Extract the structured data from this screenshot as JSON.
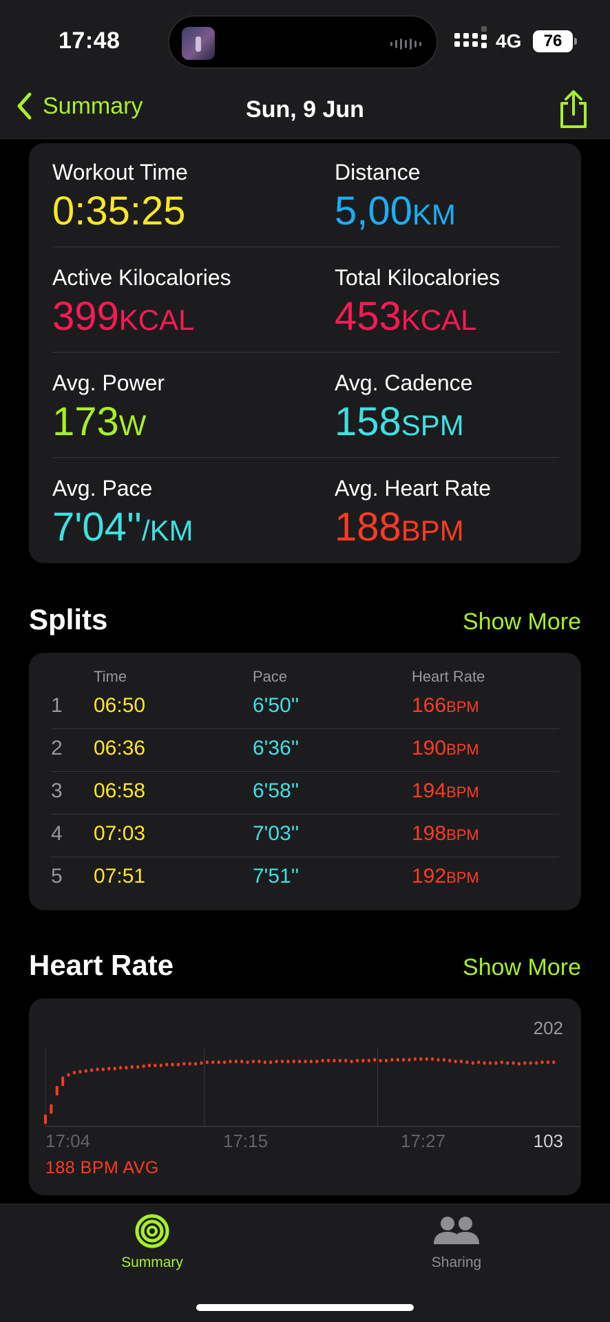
{
  "status": {
    "time": "17:48",
    "network": "4G",
    "battery": "76"
  },
  "nav": {
    "back_label": "Summary",
    "title": "Sun, 9 Jun"
  },
  "summary": {
    "metrics": [
      {
        "label": "Workout Time",
        "value": "0:35:25",
        "unit": "",
        "color": "#fde725"
      },
      {
        "label": "Distance",
        "value": "5,00",
        "unit": "KM",
        "color": "#1aaef5"
      },
      {
        "label": "Active Kilocalories",
        "value": "399",
        "unit": "KCAL",
        "color": "#ff1a55"
      },
      {
        "label": "Total Kilocalories",
        "value": "453",
        "unit": "KCAL",
        "color": "#ff1a55"
      },
      {
        "label": "Avg. Power",
        "value": "173",
        "unit": "W",
        "color": "#a8f026"
      },
      {
        "label": "Avg. Cadence",
        "value": "158",
        "unit": "SPM",
        "color": "#3fe0e0"
      },
      {
        "label": "Avg. Pace",
        "value": "7'04''",
        "unit": "/KM",
        "color": "#3fe0e0"
      },
      {
        "label": "Avg. Heart Rate",
        "value": "188",
        "unit": "BPM",
        "color": "#ff3b22"
      }
    ]
  },
  "splits": {
    "title": "Splits",
    "show_more": "Show More",
    "headers": {
      "time": "Time",
      "pace": "Pace",
      "heart_rate": "Heart Rate"
    },
    "rows": [
      {
        "index": "1",
        "time": "06:50",
        "pace": "6'50''",
        "hr": "166",
        "hr_unit": "BPM"
      },
      {
        "index": "2",
        "time": "06:36",
        "pace": "6'36''",
        "hr": "190",
        "hr_unit": "BPM"
      },
      {
        "index": "3",
        "time": "06:58",
        "pace": "6'58''",
        "hr": "194",
        "hr_unit": "BPM"
      },
      {
        "index": "4",
        "time": "07:03",
        "pace": "7'03''",
        "hr": "198",
        "hr_unit": "BPM"
      },
      {
        "index": "5",
        "time": "07:51",
        "pace": "7'51''",
        "hr": "192",
        "hr_unit": "BPM"
      }
    ]
  },
  "heart_rate": {
    "title": "Heart Rate",
    "show_more": "Show More",
    "max_label": "202",
    "min_label": "103",
    "avg_label": "188 BPM AVG",
    "x_ticks": [
      "17:04",
      "17:15",
      "17:27"
    ]
  },
  "chart_data": {
    "type": "scatter",
    "title": "",
    "xlabel": "",
    "ylabel": "",
    "ylim": [
      103,
      202
    ],
    "x_ticks": [
      "17:04",
      "17:15",
      "17:27"
    ],
    "color": "#ff3b22",
    "x": [
      0,
      0.4,
      0.8,
      1.2,
      1.6,
      2.0,
      2.4,
      2.8,
      3.2,
      3.6,
      4.0,
      4.4,
      4.8,
      5.2,
      5.6,
      6.0,
      6.4,
      6.8,
      7.2,
      7.6,
      8.0,
      8.4,
      8.8,
      9.2,
      9.6,
      10.0,
      10.4,
      10.8,
      11.2,
      11.6,
      12.0,
      12.4,
      12.8,
      13.2,
      13.6,
      14.0,
      14.4,
      14.8,
      15.2,
      15.6,
      16.0,
      16.4,
      16.8,
      17.2,
      17.6,
      18.0,
      18.4,
      18.8,
      19.2,
      19.6,
      20.0,
      20.4,
      20.8,
      21.2,
      21.6,
      22.0,
      22.4,
      22.8,
      23.2,
      23.6,
      24.0,
      24.4,
      24.8,
      25.2,
      25.6,
      26.0,
      26.4,
      26.8,
      27.2,
      27.6,
      28.0,
      28.4,
      28.8,
      29.2,
      29.6,
      30.0,
      30.4,
      30.8,
      31.2,
      31.6,
      32.0,
      32.4,
      32.8,
      33.2,
      33.6,
      34.0,
      34.4,
      34.8,
      35.2
    ],
    "y": [
      112,
      125,
      148,
      160,
      168,
      171,
      172,
      173,
      174,
      175,
      175,
      176,
      176,
      177,
      177,
      178,
      178,
      179,
      180,
      180,
      180,
      181,
      181,
      181,
      182,
      182,
      182,
      183,
      184,
      184,
      184,
      184,
      185,
      185,
      185,
      184,
      185,
      185,
      184,
      184,
      185,
      185,
      185,
      185,
      185,
      185,
      185,
      185,
      186,
      186,
      186,
      186,
      186,
      185,
      186,
      186,
      186,
      187,
      186,
      186,
      187,
      187,
      187,
      187,
      188,
      188,
      188,
      188,
      187,
      187,
      186,
      185,
      185,
      184,
      183,
      184,
      183,
      183,
      183,
      184,
      183,
      183,
      182,
      183,
      183,
      183,
      184,
      184,
      184
    ],
    "x_unit": "minutes from 17:04"
  },
  "tabs": [
    {
      "label": "Summary",
      "icon": "activity-rings-icon",
      "active": true,
      "color": "#a8f026"
    },
    {
      "label": "Sharing",
      "icon": "people-icon",
      "active": false,
      "color": "#8e8e93"
    }
  ]
}
